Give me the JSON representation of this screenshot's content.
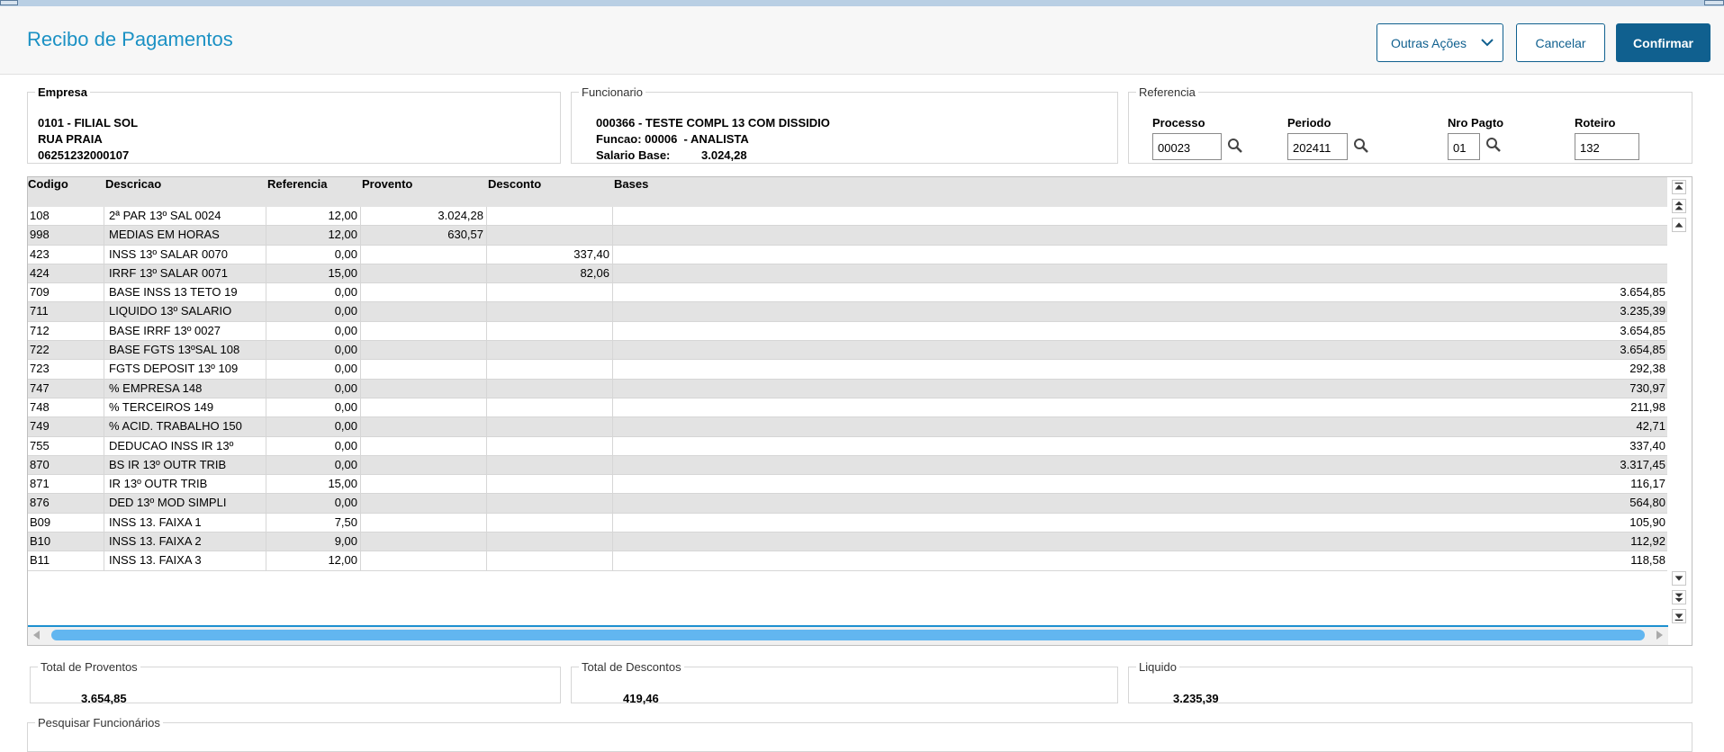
{
  "page": {
    "title": "Recibo de Pagamentos"
  },
  "actions": {
    "outras": "Outras Ações",
    "cancelar": "Cancelar",
    "confirmar": "Confirmar"
  },
  "empresa": {
    "legend": "Empresa",
    "lines": [
      "0101 - FILIAL SOL",
      "RUA PRAIA",
      "06251232000107"
    ]
  },
  "funcionario": {
    "legend": "Funcionario",
    "nome": "000366 - TESTE COMPL 13 COM DISSIDIO",
    "funcao": "Funcao: 00006  - ANALISTA",
    "salario_label": "Salario Base:",
    "salario_valor": "3.024,28"
  },
  "referencia": {
    "legend": "Referencia",
    "processo": {
      "label": "Processo",
      "value": "00023"
    },
    "periodo": {
      "label": "Periodo",
      "value": "202411"
    },
    "nro_pagto": {
      "label": "Nro Pagto",
      "value": "01"
    },
    "roteiro": {
      "label": "Roteiro",
      "value": "132"
    }
  },
  "table": {
    "columns": [
      "Codigo",
      "Descricao",
      "Referencia",
      "Provento",
      "Desconto",
      "Bases"
    ],
    "rows": [
      [
        "108",
        "2ª PAR 13º SAL 0024",
        "12,00",
        "3.024,28",
        "",
        ""
      ],
      [
        "998",
        "MEDIAS EM HORAS",
        "12,00",
        "630,57",
        "",
        ""
      ],
      [
        "423",
        "INSS 13º SALAR 0070",
        "0,00",
        "",
        "337,40",
        ""
      ],
      [
        "424",
        "IRRF 13º SALAR 0071",
        "15,00",
        "",
        "82,06",
        ""
      ],
      [
        "709",
        "BASE INSS 13 TETO 19",
        "0,00",
        "",
        "",
        "3.654,85"
      ],
      [
        "711",
        "LIQUIDO 13º SALARIO",
        "0,00",
        "",
        "",
        "3.235,39"
      ],
      [
        "712",
        "BASE IRRF 13º 0027",
        "0,00",
        "",
        "",
        "3.654,85"
      ],
      [
        "722",
        "BASE FGTS 13ºSAL 108",
        "0,00",
        "",
        "",
        "3.654,85"
      ],
      [
        "723",
        "FGTS DEPOSIT 13º 109",
        "0,00",
        "",
        "",
        "292,38"
      ],
      [
        "747",
        "% EMPRESA  148",
        "0,00",
        "",
        "",
        "730,97"
      ],
      [
        "748",
        "% TERCEIROS 149",
        "0,00",
        "",
        "",
        "211,98"
      ],
      [
        "749",
        "% ACID. TRABALHO 150",
        "0,00",
        "",
        "",
        "42,71"
      ],
      [
        "755",
        "DEDUCAO INSS IR 13º",
        "0,00",
        "",
        "",
        "337,40"
      ],
      [
        "870",
        "BS IR 13º OUTR TRIB",
        "0,00",
        "",
        "",
        "3.317,45"
      ],
      [
        "871",
        "IR 13º OUTR TRIB",
        "15,00",
        "",
        "",
        "116,17"
      ],
      [
        "876",
        "DED 13º MOD SIMPLI",
        "0,00",
        "",
        "",
        "564,80"
      ],
      [
        "B09",
        "INSS 13. FAIXA 1",
        "7,50",
        "",
        "",
        "105,90"
      ],
      [
        "B10",
        "INSS 13. FAIXA 2",
        "9,00",
        "",
        "",
        "112,92"
      ],
      [
        "B11",
        "INSS 13. FAIXA 3",
        "12,00",
        "",
        "",
        "118,58"
      ]
    ]
  },
  "totais": {
    "proventos": {
      "label": "Total de Proventos",
      "value": "3.654,85"
    },
    "descontos": {
      "label": "Total de Descontos",
      "value": "419,46"
    },
    "liquido": {
      "label": "Liquido",
      "value": "3.235,39"
    }
  },
  "pesquisa": {
    "legend": "Pesquisar Funcionários"
  },
  "icons": {
    "lupa": "search-icon",
    "chevron": "chevron-down-icon"
  },
  "colors": {
    "title": "#1b91c4",
    "primary": "#10608f",
    "row_alt": "#e3e3e3",
    "scroll": "#62b6f0"
  }
}
